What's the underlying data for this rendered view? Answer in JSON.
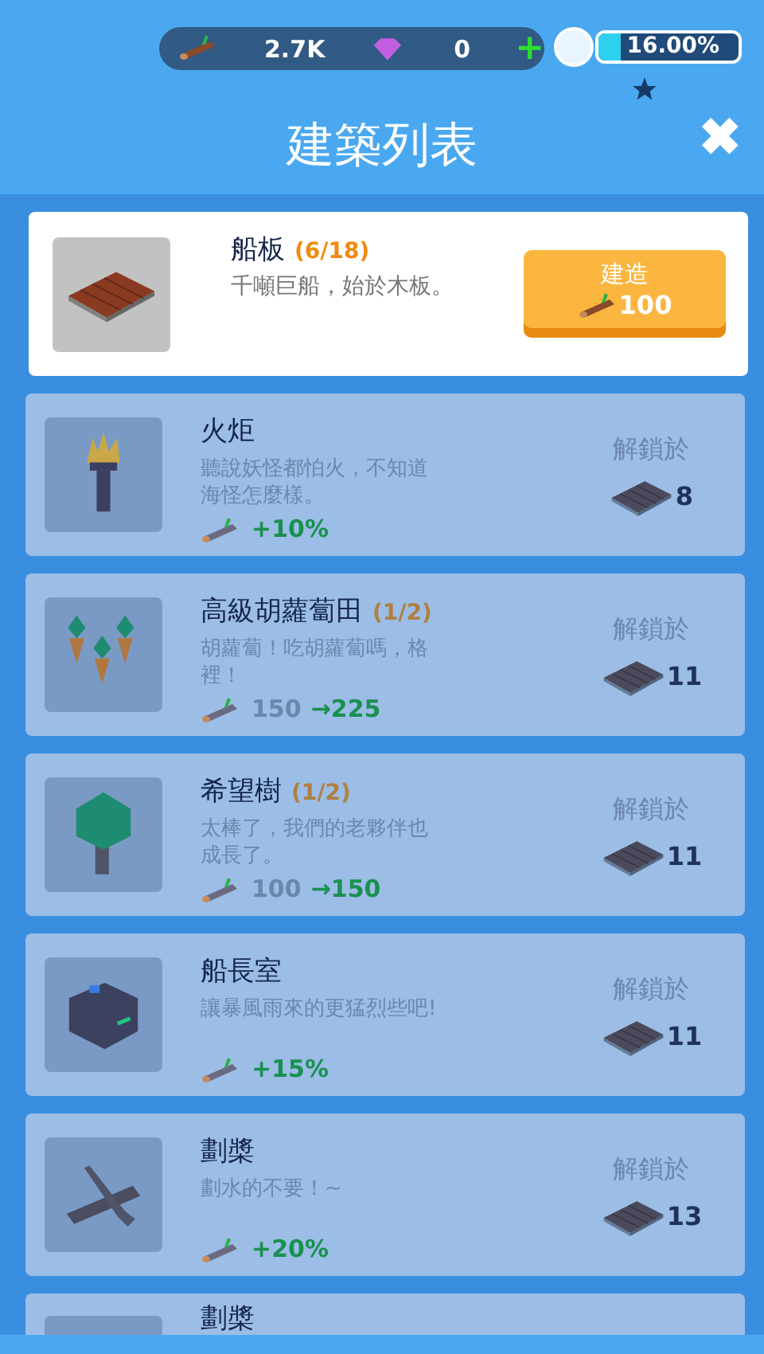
{
  "resources": {
    "wood": "2.7K",
    "gems": "0",
    "add": "+"
  },
  "progress": {
    "level": 0.16,
    "reading": "16.00%"
  },
  "title": "建築列表",
  "close": "✖",
  "items": [
    {
      "kind": "build",
      "name": "船板",
      "count": "(6/18)",
      "desc": "千噸巨船，始於木板。",
      "button": {
        "label": "建造",
        "cost": "100"
      }
    },
    {
      "kind": "locked",
      "name": "火炬",
      "desc": "聽說妖怪都怕火，不知道海怪怎麼樣。",
      "effect": {
        "kind": "bonus",
        "value": "+10%"
      },
      "unlock_label": "解鎖於",
      "unlock_cost": "8"
    },
    {
      "kind": "locked",
      "name": "高級胡蘿蔔田",
      "count": "(1/2)",
      "desc": "胡蘿蔔！吃胡蘿蔔嗎，格裡！",
      "effect": {
        "kind": "upgrade",
        "from": "150",
        "arrow": "→",
        "to": "225"
      },
      "unlock_label": "解鎖於",
      "unlock_cost": "11"
    },
    {
      "kind": "locked",
      "name": "希望樹",
      "count": "(1/2)",
      "desc": "太棒了，我們的老夥伴也成長了。",
      "effect": {
        "kind": "upgrade",
        "from": "100",
        "arrow": "→",
        "to": "150"
      },
      "unlock_label": "解鎖於",
      "unlock_cost": "11"
    },
    {
      "kind": "locked",
      "name": "船長室",
      "desc": "讓暴風雨來的更猛烈些吧!",
      "effect": {
        "kind": "bonus",
        "value": "+15%"
      },
      "unlock_label": "解鎖於",
      "unlock_cost": "11"
    },
    {
      "kind": "locked",
      "name": "劃槳",
      "desc": "劃水的不要！~",
      "effect": {
        "kind": "bonus",
        "value": "+20%"
      },
      "unlock_label": "解鎖於",
      "unlock_cost": "13"
    },
    {
      "kind": "partial",
      "name": "劃槳"
    }
  ]
}
